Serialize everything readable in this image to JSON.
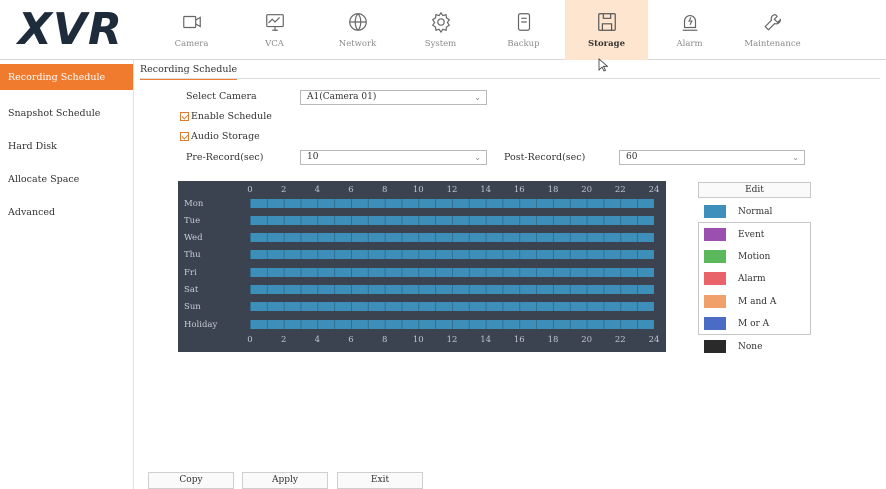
{
  "app": {
    "logo": "XVR"
  },
  "nav": [
    {
      "label": "Camera",
      "icon": "camera-icon"
    },
    {
      "label": "VCA",
      "icon": "vca-icon"
    },
    {
      "label": "Network",
      "icon": "network-icon"
    },
    {
      "label": "System",
      "icon": "gear-icon"
    },
    {
      "label": "Backup",
      "icon": "backup-icon"
    },
    {
      "label": "Storage",
      "icon": "storage-icon",
      "active": true
    },
    {
      "label": "Alarm",
      "icon": "alarm-icon"
    },
    {
      "label": "Maintenance",
      "icon": "wrench-icon"
    }
  ],
  "sidebar": {
    "items": [
      {
        "label": "Recording Schedule",
        "active": true
      },
      {
        "label": "Snapshot Schedule"
      },
      {
        "label": "Hard Disk"
      },
      {
        "label": "Allocate Space"
      },
      {
        "label": "Advanced"
      }
    ]
  },
  "tab": {
    "label": "Recording Schedule"
  },
  "form": {
    "select_camera_label": "Select Camera",
    "select_camera_value": "A1(Camera 01)",
    "enable_schedule_label": "Enable Schedule",
    "audio_storage_label": "Audio Storage",
    "pre_record_label": "Pre-Record(sec)",
    "pre_record_value": "10",
    "post_record_label": "Post-Record(sec)",
    "post_record_value": "60"
  },
  "schedule": {
    "hours": [
      "0",
      "2",
      "4",
      "6",
      "8",
      "10",
      "12",
      "14",
      "16",
      "18",
      "20",
      "22",
      "24"
    ],
    "days": [
      "Mon",
      "Tue",
      "Wed",
      "Thu",
      "Fri",
      "Sat",
      "Sun",
      "Holiday"
    ],
    "fill_mode": "Normal",
    "fill_color": "#3d8fba"
  },
  "legend": {
    "edit_label": "Edit",
    "items": [
      {
        "label": "Normal",
        "color": "#3f8fbc"
      },
      {
        "label": "Event",
        "color": "#9b4fae"
      },
      {
        "label": "Motion",
        "color": "#5cb85c"
      },
      {
        "label": "Alarm",
        "color": "#e8636a"
      },
      {
        "label": "M and A",
        "color": "#f0a06a"
      },
      {
        "label": "M or A",
        "color": "#4a6cc4"
      },
      {
        "label": "None",
        "color": "#2a2a2a"
      }
    ]
  },
  "buttons": {
    "copy": "Copy",
    "apply": "Apply",
    "exit": "Exit"
  },
  "accent_color": "#f07b2f"
}
